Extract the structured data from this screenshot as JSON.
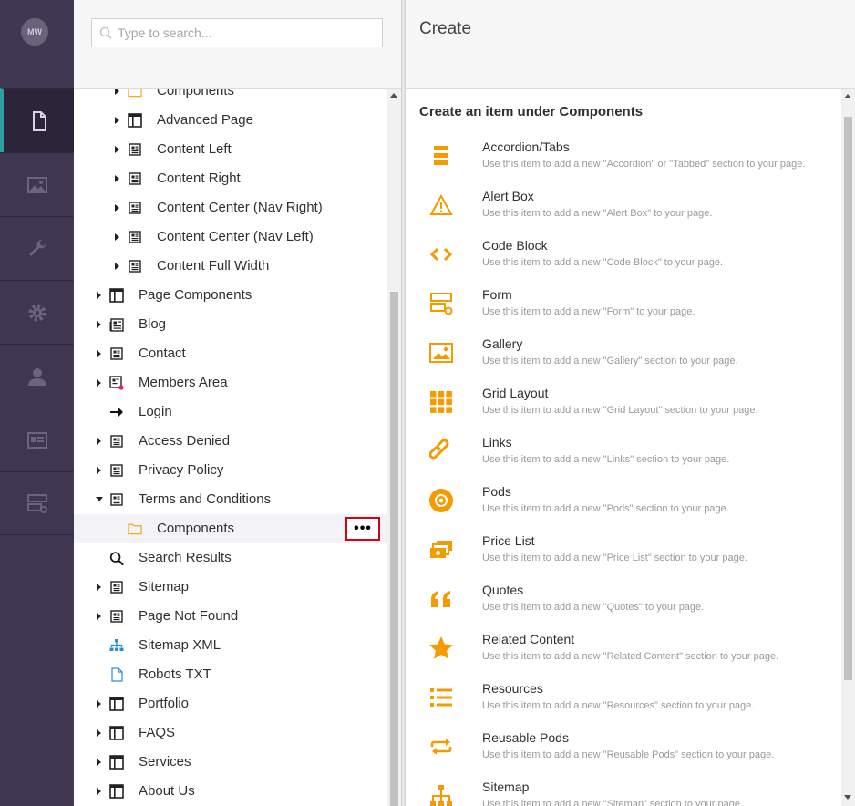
{
  "leftnav": {
    "avatar": "MW",
    "sections": [
      "content-icon",
      "media-icon",
      "settings-wrench-icon",
      "gear-icon",
      "user-icon",
      "members-card-icon",
      "forms-icon"
    ]
  },
  "tree": {
    "search_placeholder": "Type to search...",
    "rows": [
      {
        "label": "Components",
        "icon": "folder-icon",
        "level": 2,
        "caret": true
      },
      {
        "label": "Advanced Page",
        "icon": "layout-icon",
        "level": 2,
        "caret": true
      },
      {
        "label": "Content Left",
        "icon": "document-icon",
        "level": 2,
        "caret": true
      },
      {
        "label": "Content Right",
        "icon": "document-icon",
        "level": 2,
        "caret": true
      },
      {
        "label": "Content Center (Nav Right)",
        "icon": "document-icon",
        "level": 2,
        "caret": true
      },
      {
        "label": "Content Center (Nav Left)",
        "icon": "document-icon",
        "level": 2,
        "caret": true
      },
      {
        "label": "Content Full Width",
        "icon": "document-icon",
        "level": 2,
        "caret": true
      },
      {
        "label": "Page Components",
        "icon": "layout-icon",
        "level": 1,
        "caret": true
      },
      {
        "label": "Blog",
        "icon": "newspaper-icon",
        "level": 1,
        "caret": true
      },
      {
        "label": "Contact",
        "icon": "document-icon",
        "level": 1,
        "caret": true
      },
      {
        "label": "Members Area",
        "icon": "protected-document-icon",
        "level": 1,
        "caret": true
      },
      {
        "label": "Login",
        "icon": "arrow-right-icon",
        "level": 1,
        "caret": false
      },
      {
        "label": "Access Denied",
        "icon": "document-icon",
        "level": 1,
        "caret": true
      },
      {
        "label": "Privacy Policy",
        "icon": "document-icon",
        "level": 1,
        "caret": true
      },
      {
        "label": "Terms and Conditions",
        "icon": "document-icon",
        "level": 1,
        "caret": "open"
      },
      {
        "label": "Components",
        "icon": "folder-icon",
        "level": 2,
        "caret": false,
        "selected": true
      },
      {
        "label": "Search Results",
        "icon": "search-icon",
        "level": 1,
        "caret": false
      },
      {
        "label": "Sitemap",
        "icon": "document-icon",
        "level": 1,
        "caret": true
      },
      {
        "label": "Page Not Found",
        "icon": "document-icon",
        "level": 1,
        "caret": true
      },
      {
        "label": "Sitemap XML",
        "icon": "sitemap-icon",
        "level": 1,
        "caret": false
      },
      {
        "label": "Robots TXT",
        "icon": "file-icon",
        "level": 1,
        "caret": false
      },
      {
        "label": "Portfolio",
        "icon": "layout-icon",
        "level": 1,
        "caret": true
      },
      {
        "label": "FAQS",
        "icon": "layout-icon",
        "level": 1,
        "caret": true
      },
      {
        "label": "Services",
        "icon": "layout-icon",
        "level": 1,
        "caret": true
      },
      {
        "label": "About Us",
        "icon": "layout-icon",
        "level": 1,
        "caret": true
      }
    ],
    "more_button": "•••"
  },
  "create": {
    "title": "Create",
    "subtitle": "Create an item under Components",
    "items": [
      {
        "name": "Accordion/Tabs",
        "desc": "Use this item to add a new \"Accordion\" or \"Tabbed\" section to your page.",
        "icon": "accordion-icon"
      },
      {
        "name": "Alert Box",
        "desc": "Use this item to add a new \"Alert Box\" to your page.",
        "icon": "alert-icon"
      },
      {
        "name": "Code Block",
        "desc": "Use this item to add a new \"Code Block\" to your page.",
        "icon": "code-icon"
      },
      {
        "name": "Form",
        "desc": "Use this item to add a new \"Form\" to your page.",
        "icon": "form-icon"
      },
      {
        "name": "Gallery",
        "desc": "Use this item to add a new \"Gallery\" section to your page.",
        "icon": "gallery-icon"
      },
      {
        "name": "Grid Layout",
        "desc": "Use this item to add a new \"Grid Layout\" section to your page.",
        "icon": "grid-icon"
      },
      {
        "name": "Links",
        "desc": "Use this item to add a new \"Links\" section to your page.",
        "icon": "link-icon"
      },
      {
        "name": "Pods",
        "desc": "Use this item to add a new \"Pods\" section to your page.",
        "icon": "pods-icon"
      },
      {
        "name": "Price List",
        "desc": "Use this item to add a new \"Price List\" section to your page.",
        "icon": "price-list-icon"
      },
      {
        "name": "Quotes",
        "desc": "Use this item to add a new \"Quotes\" to your page.",
        "icon": "quote-icon"
      },
      {
        "name": "Related Content",
        "desc": "Use this item to add a new \"Related Content\" section to your page.",
        "icon": "star-icon"
      },
      {
        "name": "Resources",
        "desc": "Use this item to add a new \"Resources\" section to your page.",
        "icon": "list-icon"
      },
      {
        "name": "Reusable Pods",
        "desc": "Use this item to add a new \"Reusable Pods\" section to your page.",
        "icon": "repeat-icon"
      },
      {
        "name": "Sitemap",
        "desc": "Use this item to add a new \"Sitemap\" section to your page.",
        "icon": "sitemap-icon"
      }
    ]
  },
  "colors": {
    "nav_bg": "#3f3651",
    "accent": "#f59b00",
    "active_bar": "#2e9ea1",
    "highlight": "#d0021b"
  }
}
